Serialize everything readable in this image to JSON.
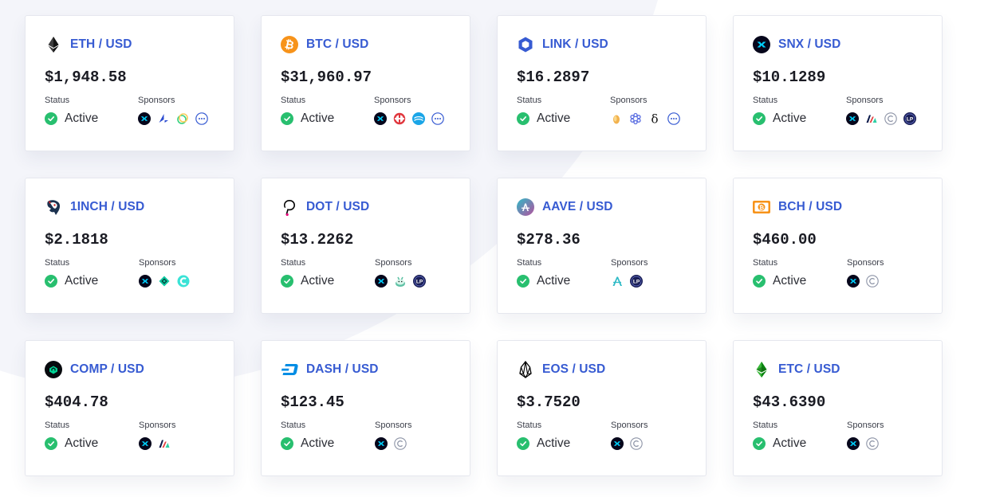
{
  "labels": {
    "status": "Status",
    "sponsors": "Sponsors"
  },
  "colors": {
    "accent": "#375bd2",
    "active": "#28bf6f",
    "text": "#1a1b23",
    "background_shape": "#f4f5fa"
  },
  "feeds": [
    {
      "pair": "ETH / USD",
      "price": "$1,948.58",
      "status": "Active",
      "icon": "ethereum-icon",
      "sponsors": [
        "synthetix-icon",
        "loopring-icon",
        "celo-icon",
        "more-icon"
      ]
    },
    {
      "pair": "BTC / USD",
      "price": "$31,960.97",
      "status": "Active",
      "icon": "bitcoin-icon",
      "sponsors": [
        "synthetix-icon",
        "cream-icon",
        "waves-icon",
        "more-icon"
      ]
    },
    {
      "pair": "LINK / USD",
      "price": "$16.2897",
      "status": "Active",
      "icon": "chainlink-icon",
      "sponsors": [
        "hand-icon",
        "snowflake-icon",
        "delta-icon",
        "more-icon"
      ]
    },
    {
      "pair": "SNX / USD",
      "price": "$10.1289",
      "status": "Active",
      "icon": "synthetix-icon",
      "sponsors": [
        "synthetix-icon",
        "mstable-icon",
        "copyright-icon",
        "uma-icon"
      ]
    },
    {
      "pair": "1INCH / USD",
      "price": "$2.1818",
      "status": "Active",
      "icon": "1inch-icon",
      "sponsors": [
        "synthetix-icon",
        "diamond-icon",
        "circle-c-icon"
      ]
    },
    {
      "pair": "DOT / USD",
      "price": "$13.2262",
      "status": "Active",
      "icon": "polkadot-icon",
      "sponsors": [
        "synthetix-icon",
        "cake-icon",
        "uma-icon"
      ]
    },
    {
      "pair": "AAVE / USD",
      "price": "$278.36",
      "status": "Active",
      "icon": "aave-icon",
      "sponsors": [
        "aave-sponsor-icon",
        "uma-icon"
      ]
    },
    {
      "pair": "BCH / USD",
      "price": "$460.00",
      "status": "Active",
      "icon": "bitcoin-cash-icon",
      "sponsors": [
        "synthetix-icon",
        "copyright-icon"
      ]
    },
    {
      "pair": "COMP / USD",
      "price": "$404.78",
      "status": "Active",
      "icon": "compound-icon",
      "sponsors": [
        "synthetix-icon",
        "mstable-icon"
      ]
    },
    {
      "pair": "DASH / USD",
      "price": "$123.45",
      "status": "Active",
      "icon": "dash-icon",
      "sponsors": [
        "synthetix-icon",
        "copyright-icon"
      ]
    },
    {
      "pair": "EOS / USD",
      "price": "$3.7520",
      "status": "Active",
      "icon": "eos-icon",
      "sponsors": [
        "synthetix-icon",
        "copyright-icon"
      ]
    },
    {
      "pair": "ETC / USD",
      "price": "$43.6390",
      "status": "Active",
      "icon": "ethereum-classic-icon",
      "sponsors": [
        "synthetix-icon",
        "copyright-icon"
      ]
    }
  ]
}
